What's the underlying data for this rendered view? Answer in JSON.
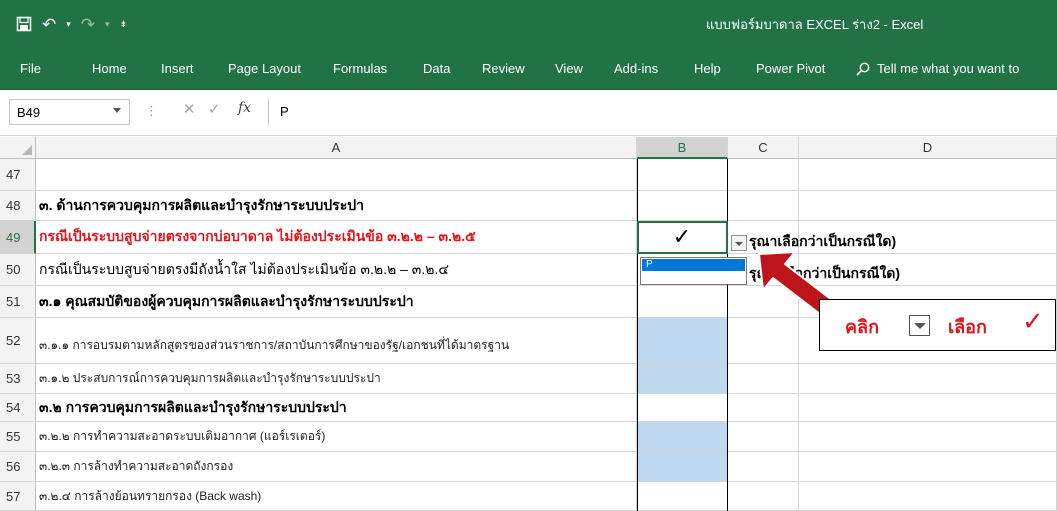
{
  "window": {
    "title": "แบบฟอร์มบาดาล EXCEL ร่าง2  -  Excel",
    "qat_icons": [
      "save-icon",
      "undo-icon",
      "redo-icon",
      "customize-qat-icon"
    ]
  },
  "ribbon": {
    "tabs": [
      "File",
      "Home",
      "Insert",
      "Page Layout",
      "Formulas",
      "Data",
      "Review",
      "View",
      "Add-ins",
      "Help",
      "Power Pivot"
    ],
    "tell_me": "Tell me what you want to"
  },
  "formula_bar": {
    "name_box": "B49",
    "fx_label": "fx",
    "value": "P"
  },
  "columns": [
    "A",
    "B",
    "C",
    "D"
  ],
  "rows": [
    {
      "num": "47",
      "a": "",
      "style": "normal",
      "b": "",
      "b_fill": false
    },
    {
      "num": "48",
      "a": "๓. ด้านการควบคุมการผลิตและบำรุงรักษาระบบประปา",
      "style": "bold",
      "b": "",
      "b_fill": false
    },
    {
      "num": "49",
      "a": "กรณีเป็นระบบสูบจ่ายตรงจากบ่อบาดาล ไม่ต้องประเมินข้อ ๓.๒.๒ – ๓.๒.๕",
      "style": "red",
      "b": "✓",
      "b_fill": false
    },
    {
      "num": "50",
      "a": "กรณีเป็นระบบสูบจ่ายตรงมีถังน้ำใส ไม่ต้องประเมินข้อ ๓.๒.๒ – ๓.๒.๔",
      "style": "medium",
      "b": "",
      "b_fill": false
    },
    {
      "num": "51",
      "a": "๓.๑ คุณสมบัติของผู้ควบคุมการผลิตและบำรุงรักษาระบบประปา",
      "style": "bold",
      "b": "",
      "b_fill": false
    },
    {
      "num": "52",
      "a": "๓.๑.๑ การอบรมตามหลักสูตรของส่วนราชการ/สถาบันการศึกษาของรัฐ/เอกชนที่ได้มาตรฐาน",
      "style": "small",
      "b": "",
      "b_fill": true
    },
    {
      "num": "53",
      "a": "๓.๑.๒ ประสบการณ์การควบคุมการผลิตและบำรุงรักษาระบบประปา",
      "style": "small",
      "b": "",
      "b_fill": true
    },
    {
      "num": "54",
      "a": "๓.๒ การควบคุมการผลิตและบำรุงรักษาระบบประปา",
      "style": "bold",
      "b": "",
      "b_fill": false
    },
    {
      "num": "55",
      "a": "๓.๒.๒ การทำความสะอาดระบบเติมอากาศ (แอร์เรเตอร์)",
      "style": "small",
      "b": "",
      "b_fill": true
    },
    {
      "num": "56",
      "a": "๓.๒.๓ การล้างทำความสะอาดถังกรอง",
      "style": "small",
      "b": "",
      "b_fill": true
    },
    {
      "num": "57",
      "a": "๓.๒.๔ การล้างย้อนทรายกรอง (Back wash)",
      "style": "small",
      "b": "",
      "b_fill": false
    }
  ],
  "overflow_text": {
    "row49_c": "รุณาเลือกว่าเป็นกรณีใด)",
    "row50_c": "รุณ  าเลือกว่าเป็นกรณีใด)"
  },
  "dropdown": {
    "option": "P"
  },
  "callout": {
    "click_text": "คลิก",
    "select_text": "เลือก",
    "check": "✓",
    "accent": "#e0161e"
  },
  "colors": {
    "excel_green": "#217346",
    "input_fill": "#bdd7ee",
    "arrow_red": "#c0141c"
  }
}
